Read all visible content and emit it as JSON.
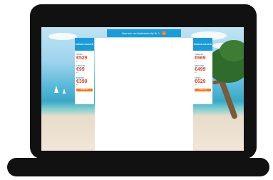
{
  "banner": {
    "text": "Naar een van Nederlands zijn Nr. 1",
    "arrow": ">"
  },
  "ads": {
    "left": {
      "logo": "ZONNIGE VAKANTIE",
      "items": [
        {
          "dest": "ARUBA",
          "price": "€529",
          "note": "p.p."
        },
        {
          "dest": "CURAÇAO",
          "price": "€99",
          "note": "p.p."
        },
        {
          "dest": "BONAIRE",
          "price": "€399",
          "note": "p.p."
        }
      ],
      "cta": "BOEK NU"
    },
    "right": {
      "logo": "ZONNIGE VAKANTIE",
      "items": [
        {
          "dest": "CURAÇAO",
          "price": "€669",
          "note": "p.p."
        },
        {
          "dest": "NEW YORK",
          "price": "€499",
          "note": "p.p."
        },
        {
          "dest": "ARUBA",
          "price": "€629",
          "note": "p.p."
        }
      ],
      "cta": "BOEK NU"
    }
  },
  "colors": {
    "accent": "#1d9bd7",
    "price": "#e0462a",
    "cta": "#f47920",
    "device": "#111111"
  }
}
